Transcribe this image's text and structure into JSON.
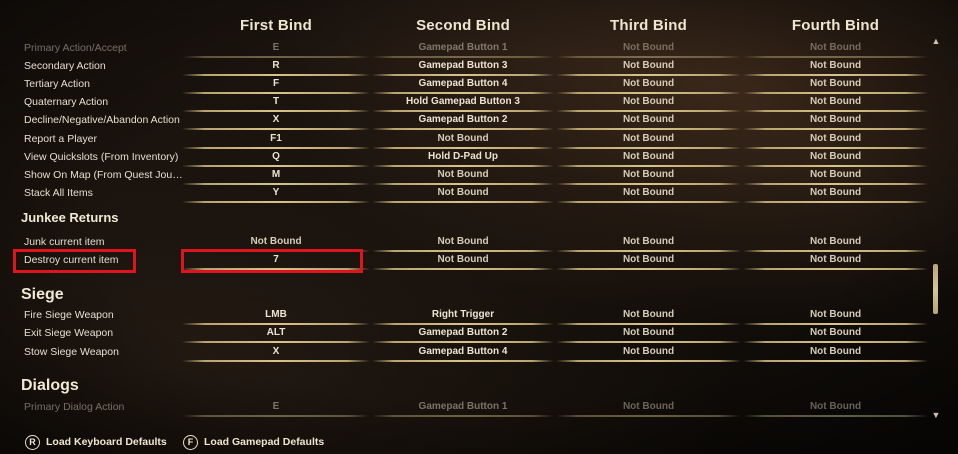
{
  "headers": [
    "First Bind",
    "Second Bind",
    "Third Bind",
    "Fourth Bind"
  ],
  "groups": {
    "general": {
      "rows": [
        {
          "label": "Primary Action/Accept",
          "binds": [
            "E",
            "Gamepad Button 1",
            "Not Bound",
            "Not Bound"
          ]
        },
        {
          "label": "Secondary Action",
          "binds": [
            "R",
            "Gamepad Button 3",
            "Not Bound",
            "Not Bound"
          ]
        },
        {
          "label": "Tertiary Action",
          "binds": [
            "F",
            "Gamepad Button 4",
            "Not Bound",
            "Not Bound"
          ]
        },
        {
          "label": "Quaternary Action",
          "binds": [
            "T",
            "Hold Gamepad Button 3",
            "Not Bound",
            "Not Bound"
          ]
        },
        {
          "label": "Decline/Negative/Abandon Action",
          "binds": [
            "X",
            "Gamepad Button 2",
            "Not Bound",
            "Not Bound"
          ]
        },
        {
          "label": "Report a Player",
          "binds": [
            "F1",
            "Not Bound",
            "Not Bound",
            "Not Bound"
          ]
        },
        {
          "label": "View Quickslots (From Inventory)",
          "binds": [
            "Q",
            "Hold D-Pad Up",
            "Not Bound",
            "Not Bound"
          ]
        },
        {
          "label": "Show On Map (From Quest Journal)",
          "binds": [
            "M",
            "Not Bound",
            "Not Bound",
            "Not Bound"
          ]
        },
        {
          "label": "Stack All Items",
          "binds": [
            "Y",
            "Not Bound",
            "Not Bound",
            "Not Bound"
          ]
        }
      ]
    },
    "junkee": {
      "title": "Junkee Returns",
      "rows": [
        {
          "label": "Junk current item",
          "binds": [
            "Not Bound",
            "Not Bound",
            "Not Bound",
            "Not Bound"
          ]
        },
        {
          "label": "Destroy current item",
          "binds": [
            "7",
            "Not Bound",
            "Not Bound",
            "Not Bound"
          ]
        }
      ]
    },
    "siege": {
      "title": "Siege",
      "rows": [
        {
          "label": "Fire Siege Weapon",
          "binds": [
            "LMB",
            "Right Trigger",
            "Not Bound",
            "Not Bound"
          ]
        },
        {
          "label": "Exit Siege Weapon",
          "binds": [
            "ALT",
            "Gamepad Button 2",
            "Not Bound",
            "Not Bound"
          ]
        },
        {
          "label": "Stow Siege Weapon",
          "binds": [
            "X",
            "Gamepad Button 4",
            "Not Bound",
            "Not Bound"
          ]
        }
      ]
    },
    "dialogs": {
      "title": "Dialogs",
      "rows": [
        {
          "label": "Primary Dialog Action",
          "binds": [
            "E",
            "Gamepad Button 1",
            "Not Bound",
            "Not Bound"
          ]
        }
      ]
    }
  },
  "footer": {
    "keyboard_key": "R",
    "keyboard_label": "Load Keyboard Defaults",
    "gamepad_key": "F",
    "gamepad_label": "Load Gamepad Defaults"
  },
  "scrollbar": {
    "up_icon": "▲",
    "down_icon": "▼"
  },
  "colors": {
    "highlight": "#e0141c",
    "text": "#e8e0cc",
    "underline": "#d8c38c"
  }
}
